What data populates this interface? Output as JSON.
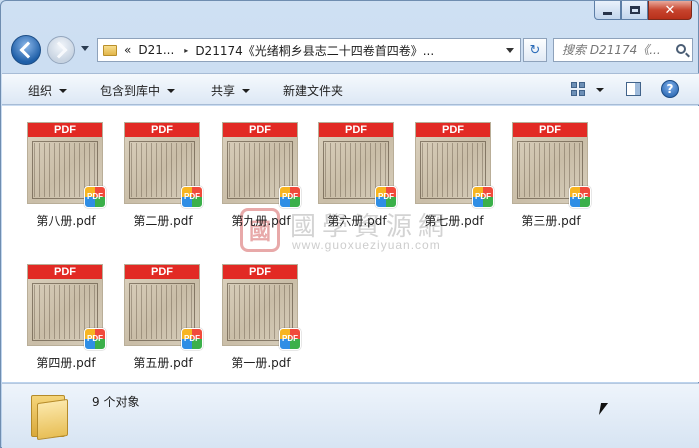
{
  "window": {
    "caption": {
      "minimize": "—",
      "maximize": "□",
      "close": "✕"
    }
  },
  "address": {
    "chevron": "«",
    "crumb_root": "D21...",
    "separator": "▸",
    "crumb_current": "D21174《光绪桐乡县志二十四卷首四卷》...",
    "refresh_glyph": "↻"
  },
  "search": {
    "placeholder": "搜索 D21174《..."
  },
  "commands": {
    "organize": "组织",
    "include_in_library": "包含到库中",
    "share": "共享",
    "new_folder": "新建文件夹",
    "help": "?"
  },
  "files": [
    {
      "name": "第八册.pdf",
      "badge": "PDF"
    },
    {
      "name": "第二册.pdf",
      "badge": "PDF"
    },
    {
      "name": "第九册.pdf",
      "badge": "PDF"
    },
    {
      "name": "第六册.pdf",
      "badge": "PDF"
    },
    {
      "name": "第七册.pdf",
      "badge": "PDF"
    },
    {
      "name": "第三册.pdf",
      "badge": "PDF"
    },
    {
      "name": "第四册.pdf",
      "badge": "PDF"
    },
    {
      "name": "第五册.pdf",
      "badge": "PDF"
    },
    {
      "name": "第一册.pdf",
      "badge": "PDF"
    }
  ],
  "pdf_band_label": "PDF",
  "watermark": {
    "seal": "國",
    "title": "國學資源網",
    "url": "www.guoxueziyuan.com"
  },
  "details": {
    "count": "9 个对象"
  },
  "colors": {
    "pdf_band": "#e22a24",
    "window_frame": "#b9d1ec"
  }
}
